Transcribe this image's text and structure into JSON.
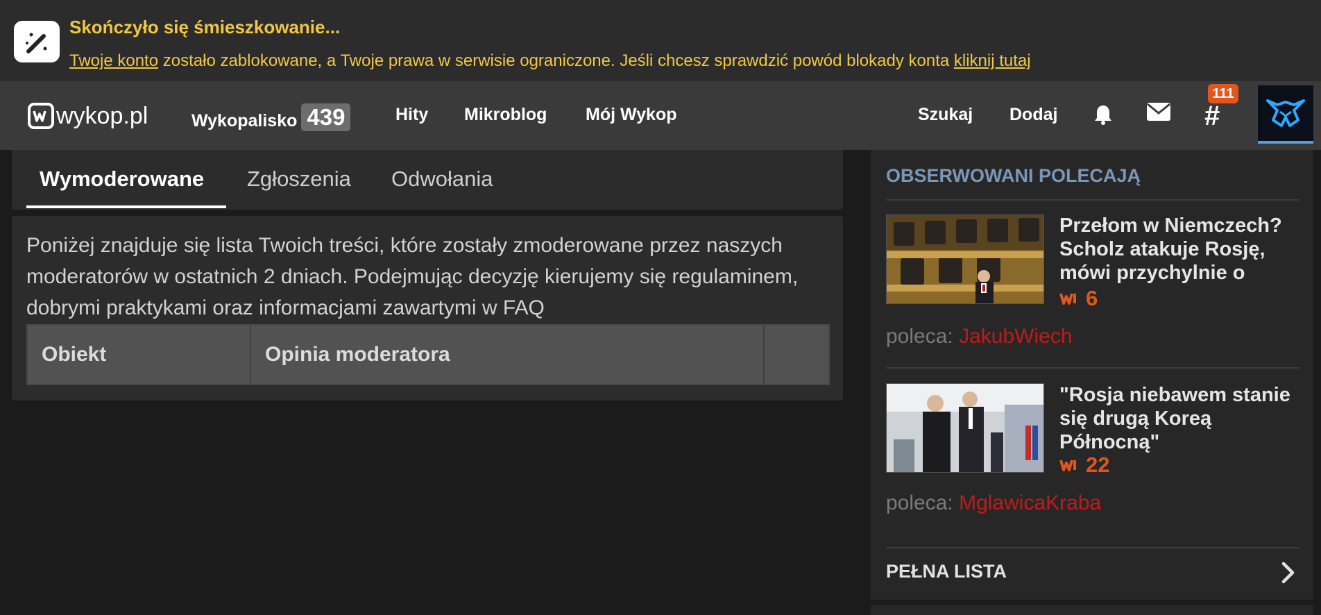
{
  "banner": {
    "title": "Skończyło się śmieszkowanie...",
    "link_account": "Twoje konto",
    "text_middle": " zostało zablokowane, a Twoje prawa w serwisie ograniczone. Jeśli chcesz sprawdzić powód blokady konta ",
    "link_click": "kliknij tutaj",
    "text_color": "#f2c744"
  },
  "nav": {
    "logo_text": "wykop.pl",
    "items": [
      {
        "label": "Wykopalisko",
        "count": "439"
      },
      {
        "label": "Hity"
      },
      {
        "label": "Mikroblog"
      },
      {
        "label": "Mój Wykop"
      }
    ],
    "search_label": "Szukaj",
    "add_label": "Dodaj",
    "hash_symbol": "#",
    "tag_notifications": "111",
    "icons": [
      "bell-icon",
      "mail-icon",
      "hashtag-icon",
      "avatar"
    ]
  },
  "tabs": [
    {
      "label": "Wymoderowane",
      "active": true
    },
    {
      "label": "Zgłoszenia",
      "active": false
    },
    {
      "label": "Odwołania",
      "active": false
    }
  ],
  "main": {
    "intro": "Poniżej znajduje się lista Twoich treści, które zostały zmoderowane przez naszych moderatorów w ostatnich 2 dniach. Podejmując decyzję kierujemy się regulaminem, dobrymi praktykami oraz informacjami zawartymi w FAQ",
    "table_headers": [
      "Obiekt",
      "Opinia moderatora",
      ""
    ]
  },
  "sidebar": {
    "heading": "OBSERWOWANI POLECAJĄ",
    "recommended_label": "poleca:",
    "items": [
      {
        "title": "Przełom w Niemczech? Scholz atakuje Rosję, mówi przychylnie o",
        "votes": "6",
        "user": "JakubWiech"
      },
      {
        "title": "\"Rosja niebawem stanie się drugą Koreą Północną\"",
        "votes": "22",
        "user": "MglawicaKraba"
      }
    ],
    "full_list": "PEŁNA LISTA"
  },
  "colors": {
    "accent_orange": "#e0561c",
    "username_red": "#c01b1b",
    "heading_blue": "#7a97b8"
  }
}
